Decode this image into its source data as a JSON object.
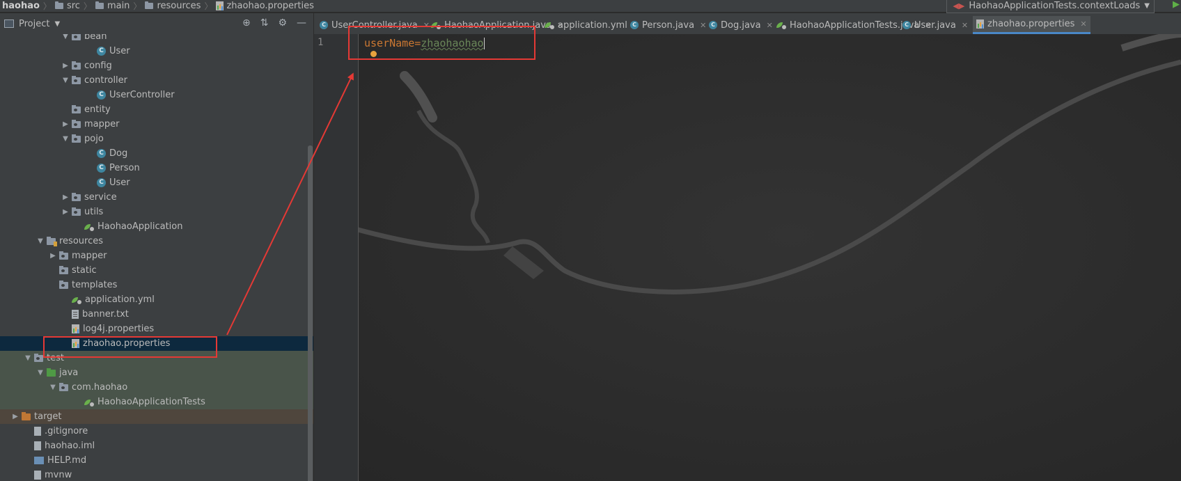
{
  "breadcrumb": [
    "haohao",
    "src",
    "main",
    "resources",
    "zhaohao.properties"
  ],
  "run_config": {
    "label": "HaohaoApplicationTests.contextLoads"
  },
  "project_panel": {
    "title": "Project"
  },
  "tree": [
    {
      "label": "bean",
      "depth": 5,
      "arrow": "▼",
      "icon": "folder"
    },
    {
      "label": "User",
      "depth": 7,
      "arrow": "",
      "icon": "class"
    },
    {
      "label": "config",
      "depth": 5,
      "arrow": "▶",
      "icon": "folder"
    },
    {
      "label": "controller",
      "depth": 5,
      "arrow": "▼",
      "icon": "folder"
    },
    {
      "label": "UserController",
      "depth": 7,
      "arrow": "",
      "icon": "class"
    },
    {
      "label": "entity",
      "depth": 5,
      "arrow": "",
      "icon": "folder"
    },
    {
      "label": "mapper",
      "depth": 5,
      "arrow": "▶",
      "icon": "folder"
    },
    {
      "label": "pojo",
      "depth": 5,
      "arrow": "▼",
      "icon": "folder"
    },
    {
      "label": "Dog",
      "depth": 7,
      "arrow": "",
      "icon": "class"
    },
    {
      "label": "Person",
      "depth": 7,
      "arrow": "",
      "icon": "class"
    },
    {
      "label": "User",
      "depth": 7,
      "arrow": "",
      "icon": "class"
    },
    {
      "label": "service",
      "depth": 5,
      "arrow": "▶",
      "icon": "folder"
    },
    {
      "label": "utils",
      "depth": 5,
      "arrow": "▶",
      "icon": "folder"
    },
    {
      "label": "HaohaoApplication",
      "depth": 6,
      "arrow": "",
      "icon": "spring"
    },
    {
      "label": "resources",
      "depth": 3,
      "arrow": "▼",
      "icon": "folder-res"
    },
    {
      "label": "mapper",
      "depth": 4,
      "arrow": "▶",
      "icon": "folder"
    },
    {
      "label": "static",
      "depth": 4,
      "arrow": "",
      "icon": "folder"
    },
    {
      "label": "templates",
      "depth": 4,
      "arrow": "",
      "icon": "folder"
    },
    {
      "label": "application.yml",
      "depth": 5,
      "arrow": "",
      "icon": "spring"
    },
    {
      "label": "banner.txt",
      "depth": 5,
      "arrow": "",
      "icon": "txt"
    },
    {
      "label": "log4j.properties",
      "depth": 5,
      "arrow": "",
      "icon": "props"
    },
    {
      "label": "zhaohao.properties",
      "depth": 5,
      "arrow": "",
      "icon": "props",
      "selected": true
    },
    {
      "label": "test",
      "depth": 2,
      "arrow": "▼",
      "icon": "folder",
      "bg": "test"
    },
    {
      "label": "java",
      "depth": 3,
      "arrow": "▼",
      "icon": "folder-green",
      "bg": "test"
    },
    {
      "label": "com.haohao",
      "depth": 4,
      "arrow": "▼",
      "icon": "folder",
      "bg": "test"
    },
    {
      "label": "HaohaoApplicationTests",
      "depth": 6,
      "arrow": "",
      "icon": "spring-test",
      "bg": "test"
    },
    {
      "label": "target",
      "depth": 1,
      "arrow": "▶",
      "icon": "folder-orange",
      "bg": "target"
    },
    {
      "label": ".gitignore",
      "depth": 2,
      "arrow": "",
      "icon": "file"
    },
    {
      "label": "haohao.iml",
      "depth": 2,
      "arrow": "",
      "icon": "iml"
    },
    {
      "label": "HELP.md",
      "depth": 2,
      "arrow": "",
      "icon": "md"
    },
    {
      "label": "mvnw",
      "depth": 2,
      "arrow": "",
      "icon": "file"
    }
  ],
  "tabs": [
    {
      "label": "UserController.java",
      "icon": "class"
    },
    {
      "label": "HaohaoApplication.java",
      "icon": "spring"
    },
    {
      "label": "application.yml",
      "icon": "spring"
    },
    {
      "label": "Person.java",
      "icon": "class"
    },
    {
      "label": "Dog.java",
      "icon": "class"
    },
    {
      "label": "HaohaoApplicationTests.java",
      "icon": "spring"
    },
    {
      "label": "User.java",
      "icon": "class"
    },
    {
      "label": "zhaohao.properties",
      "icon": "props",
      "active": true
    }
  ],
  "editor": {
    "line_number": "1",
    "key": "userName",
    "equals": "=",
    "value": "zhaohaohao"
  },
  "colors": {
    "annotation_red": "#e53935",
    "selection": "#0d293e",
    "keyword": "#cc7832",
    "string": "#6a8759"
  }
}
